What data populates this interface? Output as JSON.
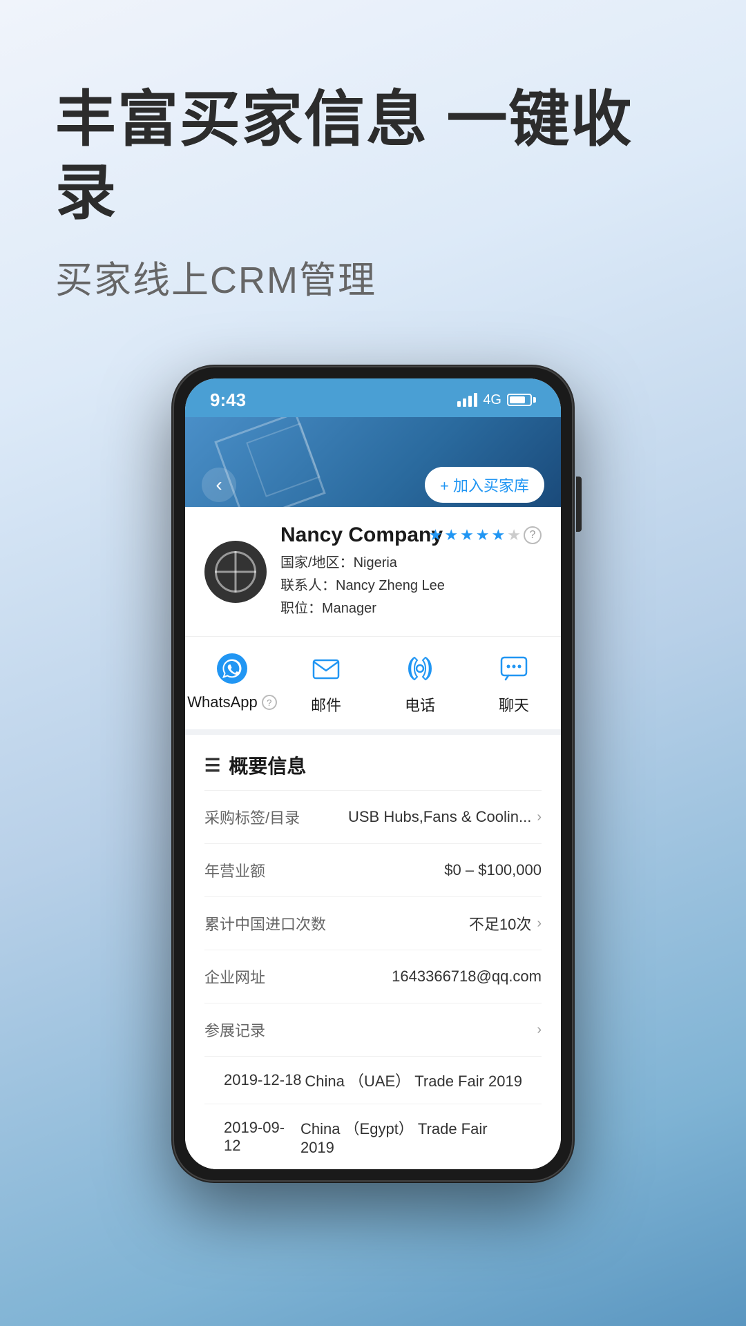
{
  "page": {
    "background_gradient_start": "#e8eef8",
    "background_gradient_end": "#7aafd4"
  },
  "header": {
    "main_title": "丰富买家信息 一键收录",
    "sub_title": "买家线上CRM管理"
  },
  "phone": {
    "status_bar": {
      "time": "9:43",
      "network": "4G"
    },
    "nav": {
      "add_button_label": "+ 加入买家库"
    },
    "company_card": {
      "name": "Nancy Company",
      "country_label": "国家/地区：",
      "country": "Nigeria",
      "contact_label": "联系人：",
      "contact": "Nancy Zheng Lee",
      "position_label": "职位：",
      "position": "Manager",
      "stars_filled": 5,
      "stars_empty": 0
    },
    "action_buttons": [
      {
        "id": "whatsapp",
        "label": "WhatsApp",
        "has_help": true
      },
      {
        "id": "email",
        "label": "邮件",
        "has_help": false
      },
      {
        "id": "phone",
        "label": "电话",
        "has_help": false
      },
      {
        "id": "chat",
        "label": "聊天",
        "has_help": false
      }
    ],
    "summary": {
      "title": "概要信息",
      "rows": [
        {
          "label": "采购标签/目录",
          "value": "USB Hubs,Fans & Coolin...",
          "has_arrow": true
        },
        {
          "label": "年营业额",
          "value": "$0 – $100,000",
          "has_arrow": false
        },
        {
          "label": "累计中国进口次数",
          "value": "不足10次",
          "has_arrow": true
        },
        {
          "label": "企业网址",
          "value": "1643366718@qq.com",
          "has_arrow": false
        },
        {
          "label": "参展记录",
          "value": "",
          "has_arrow": true
        }
      ]
    },
    "trade_fairs": [
      {
        "date": "2019-12-18",
        "event": "China （UAE） Trade Fair 2019"
      },
      {
        "date": "2019-09-12",
        "event": "China （Egypt） Trade Fair 2019"
      }
    ]
  }
}
